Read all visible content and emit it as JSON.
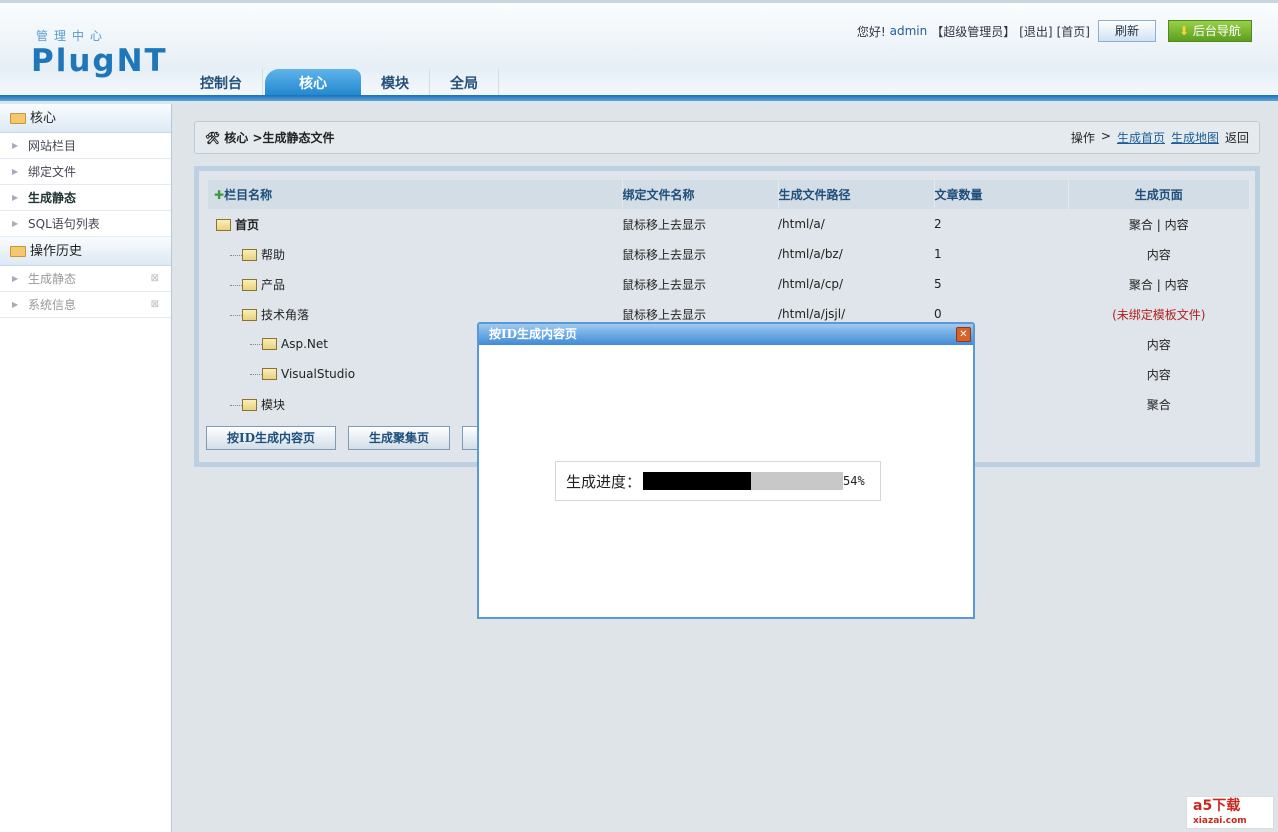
{
  "header": {
    "logo_sub": "管理中心",
    "logo": "PlugNT",
    "greeting": "您好!",
    "user": "admin",
    "role": "【超级管理员】",
    "logout": "[退出]",
    "home": "[首页]",
    "refresh": "刷新",
    "backend_nav": "后台导航"
  },
  "tabs": [
    {
      "label": "控制台"
    },
    {
      "label": "核心"
    },
    {
      "label": "模块"
    },
    {
      "label": "全局"
    }
  ],
  "sidebar": {
    "group1": "核心",
    "items": [
      "网站栏目",
      "绑定文件",
      "生成静态",
      "SQL语句列表"
    ],
    "group2": "操作历史",
    "history": [
      "生成静态",
      "系统信息"
    ]
  },
  "breadcrumb": {
    "root": "核心",
    "sep": ">",
    "current": "生成静态文件",
    "ops_label": "操作",
    "ops_sep": ">",
    "link1": "生成首页",
    "link2": "生成地图",
    "back": "返回"
  },
  "table": {
    "headers": [
      "栏目名称",
      "绑定文件名称",
      "生成文件路径",
      "文章数量",
      "生成页面"
    ],
    "rows": [
      {
        "name": "首页",
        "bind": "鼠标移上去显示",
        "path": "/html/a/",
        "count": "2",
        "gen": "聚合 | 内容"
      },
      {
        "name": "帮助",
        "bind": "鼠标移上去显示",
        "path": "/html/a/bz/",
        "count": "1",
        "gen": "内容"
      },
      {
        "name": "产品",
        "bind": "鼠标移上去显示",
        "path": "/html/a/cp/",
        "count": "5",
        "gen": "聚合 | 内容"
      },
      {
        "name": "技术角落",
        "bind": "鼠标移上去显示",
        "path": "/html/a/jsjl/",
        "count": "0",
        "gen": "(未绑定模板文件)"
      },
      {
        "name": "Asp.Net",
        "bind": "",
        "path": "",
        "count": "",
        "gen": "内容"
      },
      {
        "name": "VisualStudio",
        "bind": "",
        "path": "",
        "count": "",
        "gen": "内容"
      },
      {
        "name": "模块",
        "bind": "",
        "path": "",
        "count": "",
        "gen": "聚合"
      }
    ]
  },
  "buttons": {
    "by_id": "按ID生成内容页",
    "aggregate": "生成聚集页"
  },
  "dialog": {
    "title": "按ID生成内容页",
    "close": "✕",
    "progress_label": "生成进度：",
    "progress_percent": 54,
    "progress_text": "54%"
  },
  "watermark": {
    "brand": "a5下载",
    "domain": "xiazai.com"
  },
  "colors": {
    "accent": "#1f76b8",
    "progress_fill": "#000000",
    "warn": "#b02020"
  }
}
